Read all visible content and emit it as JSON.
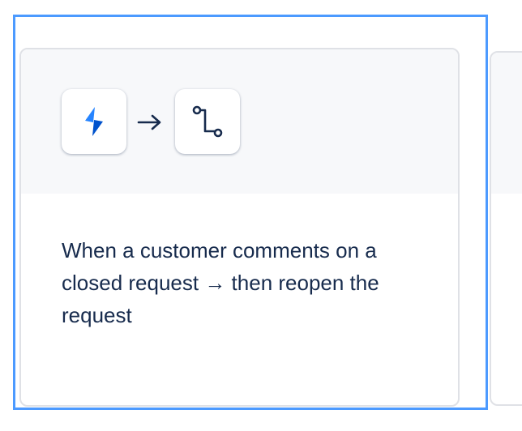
{
  "card": {
    "trigger_icon": "lightning-bolt-icon",
    "arrow_icon": "arrow-right-icon",
    "action_icon": "branch-path-icon",
    "description": "When a customer comments on a closed request → then reopen the request"
  },
  "colors": {
    "focus_ring": "#4c9aff",
    "card_border": "#dfe1e6",
    "card_header_bg": "#f7f8fa",
    "text": "#172b4d",
    "bolt_light": "#2684ff",
    "bolt_dark": "#0052cc"
  }
}
